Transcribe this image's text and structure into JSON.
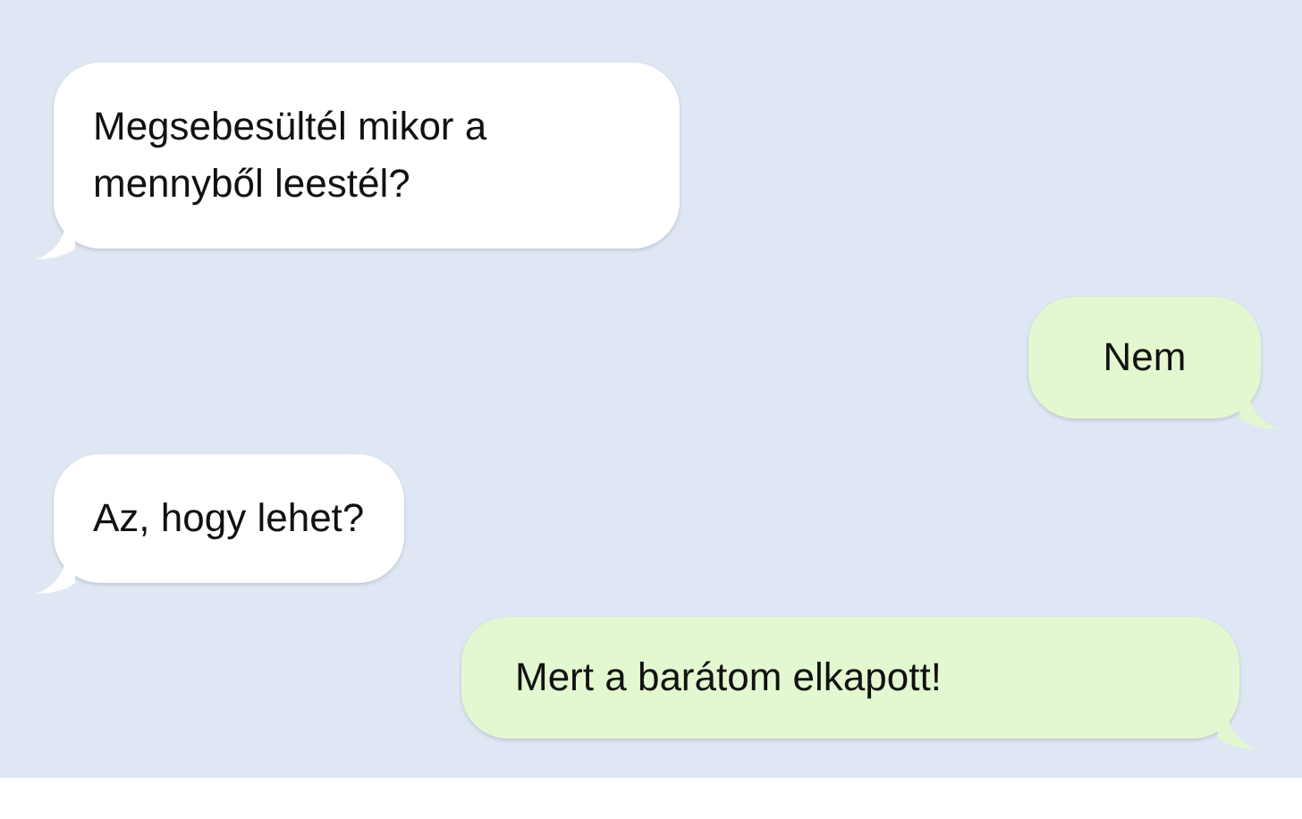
{
  "messages": [
    {
      "kind": "incoming",
      "text": "Megsebesültél mikor a mennyből leestél?"
    },
    {
      "kind": "outgoing",
      "text": "Nem"
    },
    {
      "kind": "incoming",
      "text": "Az, hogy lehet?"
    },
    {
      "kind": "outgoing",
      "text": "Mert a barátom elkapott!"
    }
  ]
}
